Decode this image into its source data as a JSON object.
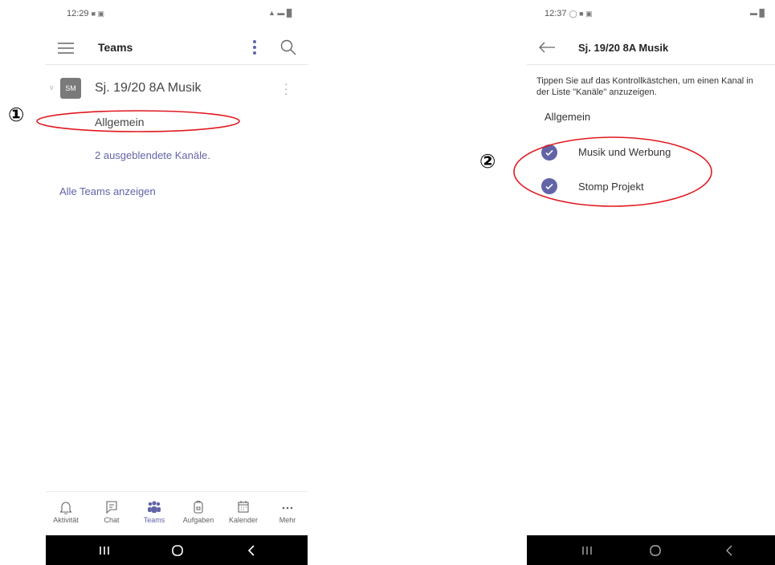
{
  "left": {
    "status": {
      "time": "12:29"
    },
    "header": {
      "title": "Teams"
    },
    "team": {
      "avatar": "SM",
      "name": "Sj. 19/20 8A Musik"
    },
    "channel_general": "Allgemein",
    "hidden_channels": "2 ausgeblendete Kanäle.",
    "all_teams": "Alle Teams anzeigen",
    "tabs": [
      {
        "label": "Aktivität",
        "icon": "bell-icon"
      },
      {
        "label": "Chat",
        "icon": "chat-icon"
      },
      {
        "label": "Teams",
        "icon": "teams-icon"
      },
      {
        "label": "Aufgaben",
        "icon": "assignments-icon"
      },
      {
        "label": "Kalender",
        "icon": "calendar-icon"
      },
      {
        "label": "Mehr",
        "icon": "more-icon"
      }
    ]
  },
  "right": {
    "status": {
      "time": "12:37"
    },
    "header": {
      "title": "Sj. 19/20 8A Musik"
    },
    "instruction": "Tippen Sie auf das Kontrollkästchen, um einen Kanal in der Liste \"Kanäle\" anzuzeigen.",
    "channel_general": "Allgemein",
    "channels": [
      {
        "label": "Musik und Werbung",
        "checked": true
      },
      {
        "label": "Stomp Projekt",
        "checked": true
      }
    ]
  },
  "annotations": {
    "one": "①",
    "two": "②"
  },
  "colors": {
    "accent": "#6264a7",
    "highlight": "#e0191f",
    "navbar": "#000000"
  }
}
